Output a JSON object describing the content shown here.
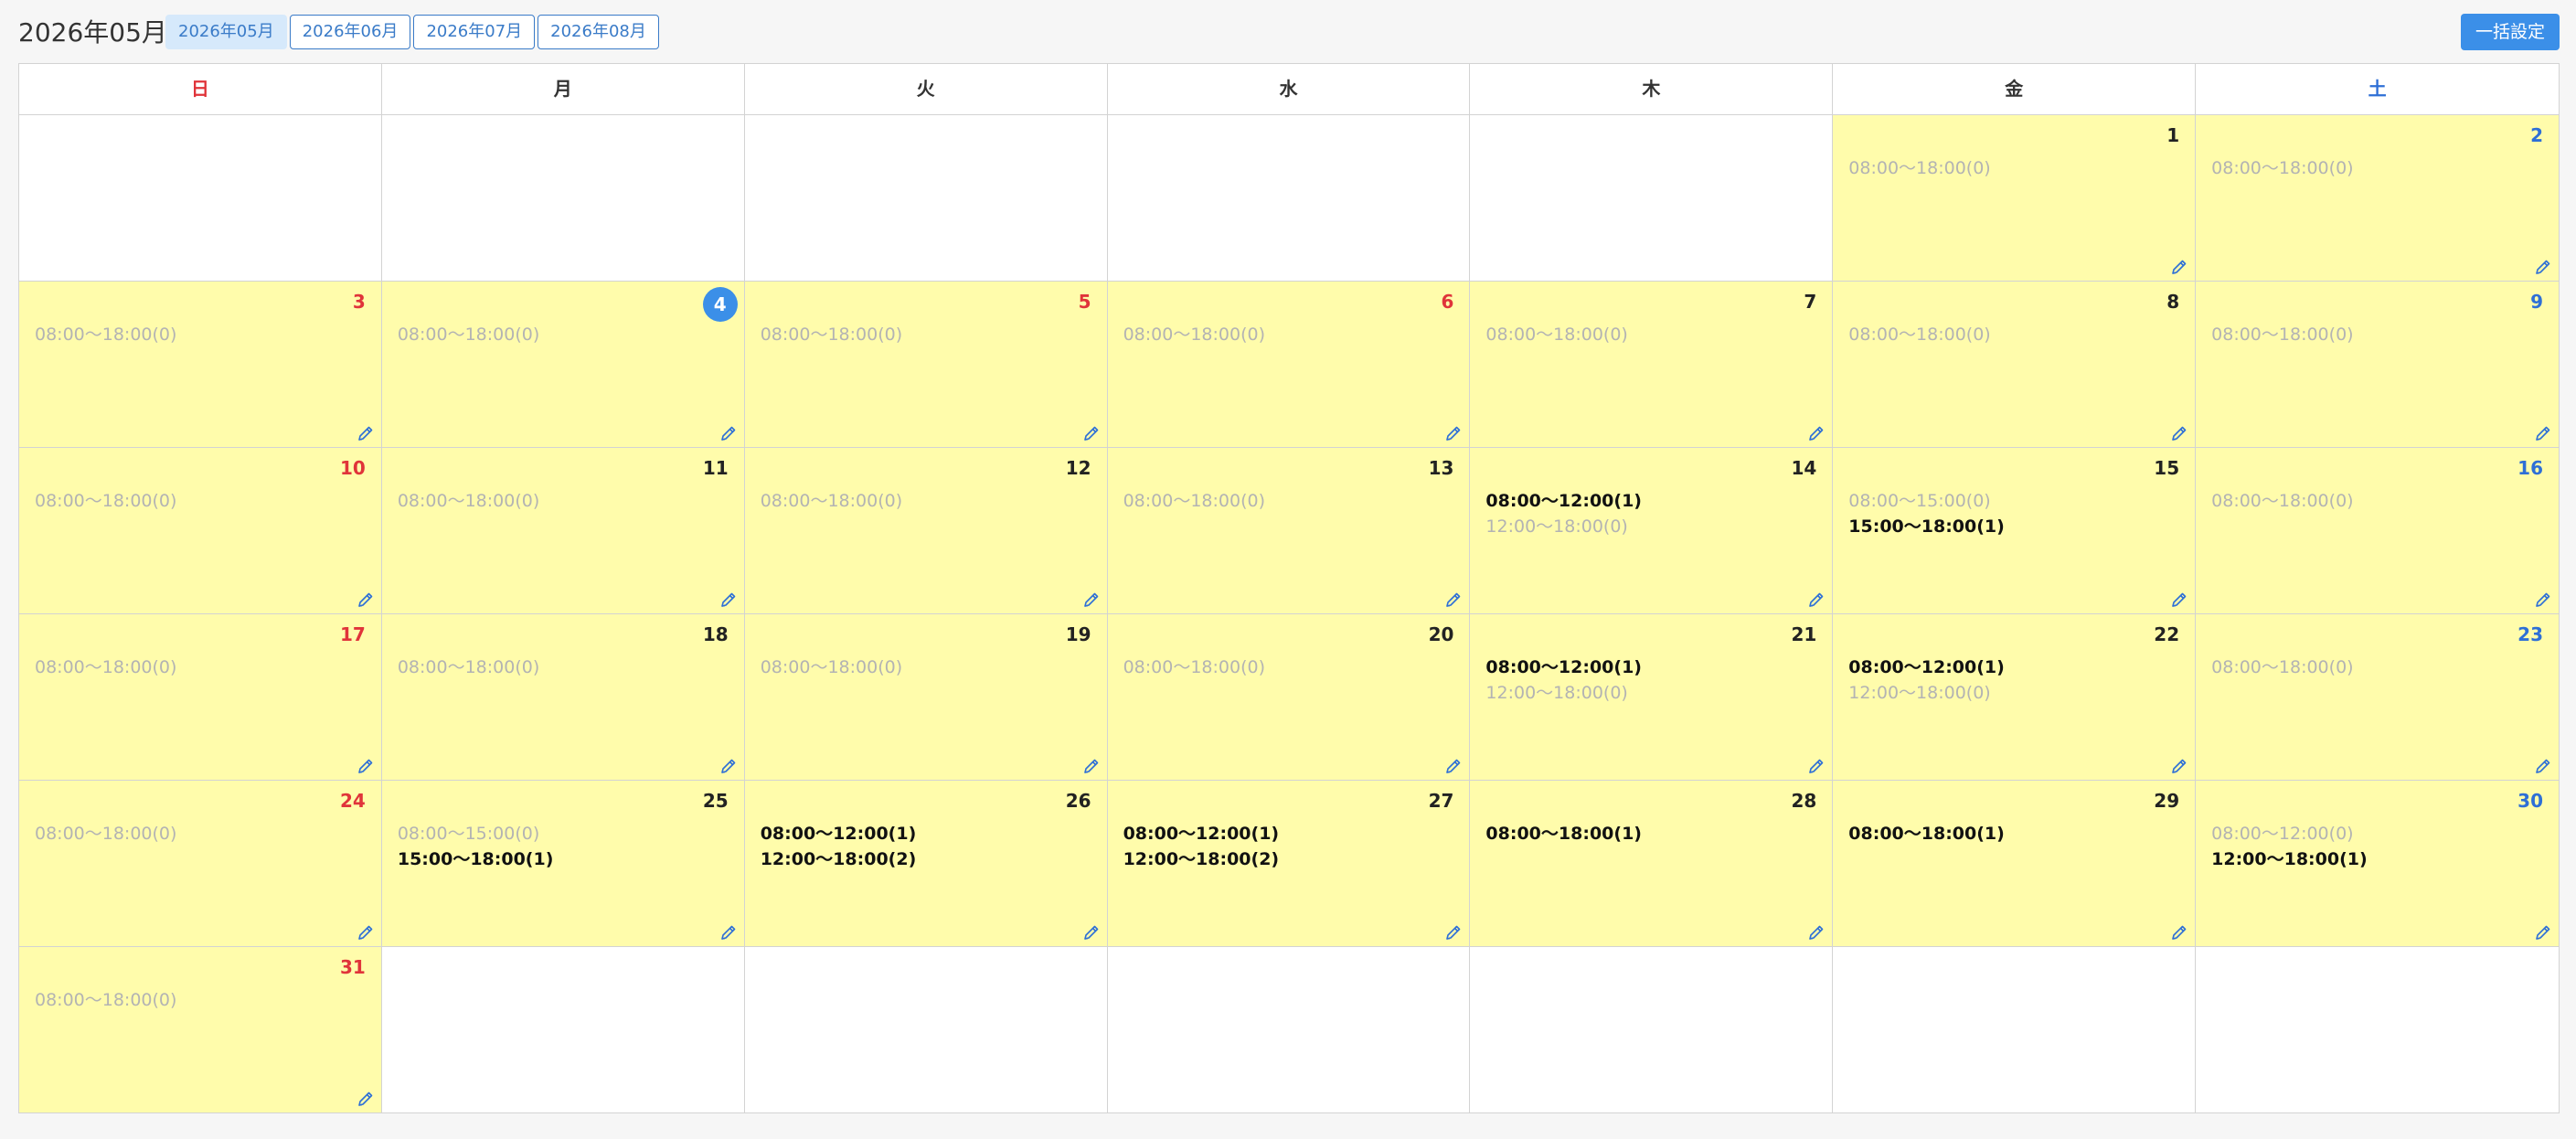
{
  "header": {
    "title": "2026年05月",
    "tabs": [
      "2026年05月",
      "2026年06月",
      "2026年07月",
      "2026年08月"
    ],
    "active_tab": 0,
    "bulk_label": "一括設定"
  },
  "colors": {
    "open_day": "#fffcab",
    "sunday": "#e0343a",
    "saturday": "#2e6fd6",
    "accent": "#3b8fe8",
    "unbooked_text": "#b3b3b3",
    "booked_text": "#111111"
  },
  "weekdays": [
    "日",
    "月",
    "火",
    "水",
    "木",
    "金",
    "土"
  ],
  "weeks": [
    [
      null,
      null,
      null,
      null,
      null,
      {
        "day": "1",
        "slots": [
          {
            "text": "08:00〜18:00(0)",
            "booked": false
          }
        ]
      },
      {
        "day": "2",
        "slots": [
          {
            "text": "08:00〜18:00(0)",
            "booked": false
          }
        ]
      }
    ],
    [
      {
        "day": "3",
        "slots": [
          {
            "text": "08:00〜18:00(0)",
            "booked": false
          }
        ]
      },
      {
        "day": "4",
        "today": true,
        "slots": [
          {
            "text": "08:00〜18:00(0)",
            "booked": false
          }
        ]
      },
      {
        "day": "5",
        "holiday": true,
        "slots": [
          {
            "text": "08:00〜18:00(0)",
            "booked": false
          }
        ]
      },
      {
        "day": "6",
        "holiday": true,
        "slots": [
          {
            "text": "08:00〜18:00(0)",
            "booked": false
          }
        ]
      },
      {
        "day": "7",
        "slots": [
          {
            "text": "08:00〜18:00(0)",
            "booked": false
          }
        ]
      },
      {
        "day": "8",
        "slots": [
          {
            "text": "08:00〜18:00(0)",
            "booked": false
          }
        ]
      },
      {
        "day": "9",
        "slots": [
          {
            "text": "08:00〜18:00(0)",
            "booked": false
          }
        ]
      }
    ],
    [
      {
        "day": "10",
        "slots": [
          {
            "text": "08:00〜18:00(0)",
            "booked": false
          }
        ]
      },
      {
        "day": "11",
        "slots": [
          {
            "text": "08:00〜18:00(0)",
            "booked": false
          }
        ]
      },
      {
        "day": "12",
        "slots": [
          {
            "text": "08:00〜18:00(0)",
            "booked": false
          }
        ]
      },
      {
        "day": "13",
        "slots": [
          {
            "text": "08:00〜18:00(0)",
            "booked": false
          }
        ]
      },
      {
        "day": "14",
        "slots": [
          {
            "text": "08:00〜12:00(1)",
            "booked": true
          },
          {
            "text": "12:00〜18:00(0)",
            "booked": false
          }
        ]
      },
      {
        "day": "15",
        "slots": [
          {
            "text": "08:00〜15:00(0)",
            "booked": false
          },
          {
            "text": "15:00〜18:00(1)",
            "booked": true
          }
        ]
      },
      {
        "day": "16",
        "slots": [
          {
            "text": "08:00〜18:00(0)",
            "booked": false
          }
        ]
      }
    ],
    [
      {
        "day": "17",
        "slots": [
          {
            "text": "08:00〜18:00(0)",
            "booked": false
          }
        ]
      },
      {
        "day": "18",
        "slots": [
          {
            "text": "08:00〜18:00(0)",
            "booked": false
          }
        ]
      },
      {
        "day": "19",
        "slots": [
          {
            "text": "08:00〜18:00(0)",
            "booked": false
          }
        ]
      },
      {
        "day": "20",
        "slots": [
          {
            "text": "08:00〜18:00(0)",
            "booked": false
          }
        ]
      },
      {
        "day": "21",
        "slots": [
          {
            "text": "08:00〜12:00(1)",
            "booked": true
          },
          {
            "text": "12:00〜18:00(0)",
            "booked": false
          }
        ]
      },
      {
        "day": "22",
        "slots": [
          {
            "text": "08:00〜12:00(1)",
            "booked": true
          },
          {
            "text": "12:00〜18:00(0)",
            "booked": false
          }
        ]
      },
      {
        "day": "23",
        "slots": [
          {
            "text": "08:00〜18:00(0)",
            "booked": false
          }
        ]
      }
    ],
    [
      {
        "day": "24",
        "slots": [
          {
            "text": "08:00〜18:00(0)",
            "booked": false
          }
        ]
      },
      {
        "day": "25",
        "slots": [
          {
            "text": "08:00〜15:00(0)",
            "booked": false
          },
          {
            "text": "15:00〜18:00(1)",
            "booked": true
          }
        ]
      },
      {
        "day": "26",
        "slots": [
          {
            "text": "08:00〜12:00(1)",
            "booked": true
          },
          {
            "text": "12:00〜18:00(2)",
            "booked": true
          }
        ]
      },
      {
        "day": "27",
        "slots": [
          {
            "text": "08:00〜12:00(1)",
            "booked": true
          },
          {
            "text": "12:00〜18:00(2)",
            "booked": true
          }
        ]
      },
      {
        "day": "28",
        "slots": [
          {
            "text": "08:00〜18:00(1)",
            "booked": true
          }
        ]
      },
      {
        "day": "29",
        "slots": [
          {
            "text": "08:00〜18:00(1)",
            "booked": true
          }
        ]
      },
      {
        "day": "30",
        "slots": [
          {
            "text": "08:00〜12:00(0)",
            "booked": false
          },
          {
            "text": "12:00〜18:00(1)",
            "booked": true
          }
        ]
      }
    ],
    [
      {
        "day": "31",
        "slots": [
          {
            "text": "08:00〜18:00(0)",
            "booked": false
          }
        ]
      },
      null,
      null,
      null,
      null,
      null,
      null
    ]
  ]
}
